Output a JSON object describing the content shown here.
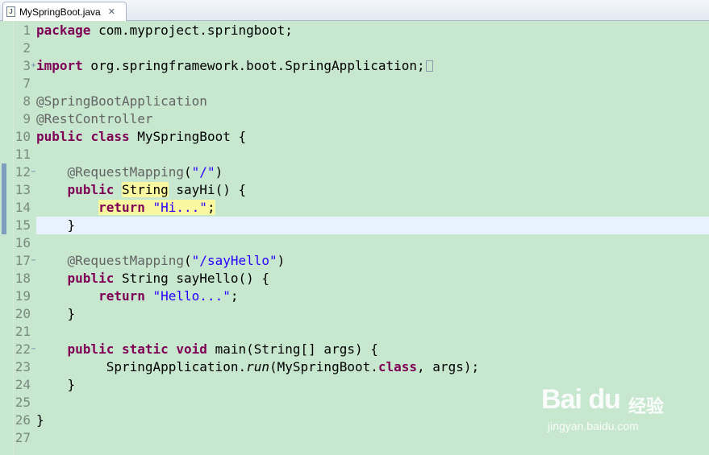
{
  "tab": {
    "title": "MySpringBoot.java",
    "icon": "java-file-icon",
    "close_glyph": "✕"
  },
  "editor": {
    "lines": [
      {
        "num": "1",
        "fold": "",
        "tokens": [
          {
            "t": "package",
            "c": "kw"
          },
          {
            "t": " com.myproject.springboot;"
          }
        ]
      },
      {
        "num": "2",
        "fold": "",
        "tokens": []
      },
      {
        "num": "3",
        "fold": "+",
        "tokens": [
          {
            "t": "import",
            "c": "kw"
          },
          {
            "t": " org.springframework.boot.SpringApplication;"
          }
        ],
        "collapsed": true
      },
      {
        "num": "7",
        "fold": "",
        "tokens": []
      },
      {
        "num": "8",
        "fold": "",
        "tokens": [
          {
            "t": "@SpringBootApplication",
            "c": "ann"
          }
        ]
      },
      {
        "num": "9",
        "fold": "",
        "tokens": [
          {
            "t": "@RestController",
            "c": "ann"
          }
        ]
      },
      {
        "num": "10",
        "fold": "",
        "tokens": [
          {
            "t": "public",
            "c": "kw"
          },
          {
            "t": " "
          },
          {
            "t": "class",
            "c": "kw"
          },
          {
            "t": " MySpringBoot {"
          }
        ]
      },
      {
        "num": "11",
        "fold": "",
        "tokens": []
      },
      {
        "num": "12",
        "fold": "−",
        "tokens": [
          {
            "t": "    "
          },
          {
            "t": "@RequestMapping",
            "c": "ann"
          },
          {
            "t": "("
          },
          {
            "t": "\"/\"",
            "c": "str"
          },
          {
            "t": ")"
          }
        ]
      },
      {
        "num": "13",
        "fold": "",
        "tokens": [
          {
            "t": "    "
          },
          {
            "t": "public",
            "c": "kw"
          },
          {
            "t": " "
          },
          {
            "t": "String",
            "c": "hl"
          },
          {
            "t": " sayHi() {"
          }
        ]
      },
      {
        "num": "14",
        "fold": "",
        "tokens": [
          {
            "t": "        "
          },
          {
            "t": "return",
            "c": "kw hl"
          },
          {
            "t": " ",
            "c": "hl"
          },
          {
            "t": "\"Hi...\"",
            "c": "str hl"
          },
          {
            "t": ";",
            "c": "hl"
          }
        ]
      },
      {
        "num": "15",
        "fold": "",
        "tokens": [
          {
            "t": "    }"
          }
        ],
        "current": true
      },
      {
        "num": "16",
        "fold": "",
        "tokens": []
      },
      {
        "num": "17",
        "fold": "−",
        "tokens": [
          {
            "t": "    "
          },
          {
            "t": "@RequestMapping",
            "c": "ann"
          },
          {
            "t": "("
          },
          {
            "t": "\"/sayHello\"",
            "c": "str"
          },
          {
            "t": ")"
          }
        ]
      },
      {
        "num": "18",
        "fold": "",
        "tokens": [
          {
            "t": "    "
          },
          {
            "t": "public",
            "c": "kw"
          },
          {
            "t": " String sayHello() {"
          }
        ]
      },
      {
        "num": "19",
        "fold": "",
        "tokens": [
          {
            "t": "        "
          },
          {
            "t": "return",
            "c": "kw"
          },
          {
            "t": " "
          },
          {
            "t": "\"Hello...\"",
            "c": "str"
          },
          {
            "t": ";"
          }
        ]
      },
      {
        "num": "20",
        "fold": "",
        "tokens": [
          {
            "t": "    }"
          }
        ]
      },
      {
        "num": "21",
        "fold": "",
        "tokens": []
      },
      {
        "num": "22",
        "fold": "−",
        "tokens": [
          {
            "t": "    "
          },
          {
            "t": "public",
            "c": "kw"
          },
          {
            "t": " "
          },
          {
            "t": "static",
            "c": "kw"
          },
          {
            "t": " "
          },
          {
            "t": "void",
            "c": "kw"
          },
          {
            "t": " main(String[] args) {"
          }
        ]
      },
      {
        "num": "23",
        "fold": "",
        "tokens": [
          {
            "t": "         SpringApplication."
          },
          {
            "t": "run",
            "c": "it"
          },
          {
            "t": "(MySpringBoot."
          },
          {
            "t": "class",
            "c": "kw"
          },
          {
            "t": ", args);"
          }
        ]
      },
      {
        "num": "24",
        "fold": "",
        "tokens": [
          {
            "t": "    }"
          }
        ]
      },
      {
        "num": "25",
        "fold": "",
        "tokens": []
      },
      {
        "num": "26",
        "fold": "",
        "tokens": [
          {
            "t": "}"
          }
        ]
      },
      {
        "num": "27",
        "fold": "",
        "tokens": []
      }
    ]
  },
  "watermark": {
    "logo": "Bai du",
    "cn": "经验",
    "url": "jingyan.baidu.com"
  }
}
